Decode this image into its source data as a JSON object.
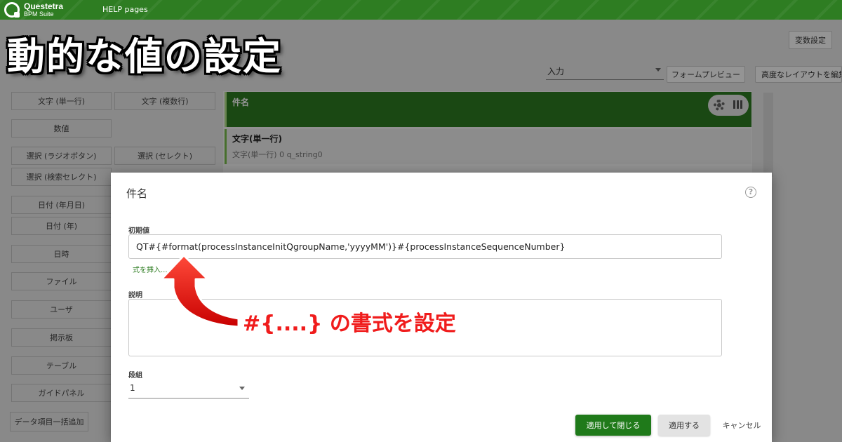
{
  "brand": {
    "name": "Questetra",
    "sub": "BPM Suite"
  },
  "topbar": {
    "help_label": "HELP pages"
  },
  "header": {
    "vars_button": "変数設定",
    "input_select": "入力",
    "form_preview_button": "フォームプレビュー",
    "advanced_layout_button": "高度なレイアウトを編集"
  },
  "palette": {
    "items": [
      "文字 (単一行)",
      "文字 (複数行)",
      "数値",
      "選択 (ラジオボタン)",
      "選択 (セレクト)",
      "選択 (検索セレクト)",
      "日付 (年月日)",
      "日付 (年)",
      "日時",
      "ファイル",
      "ユーザ",
      "掲示板",
      "テーブル",
      "ガイドパネル"
    ],
    "bulk_add_button": "データ項目一括追加"
  },
  "form": {
    "title_row_label": "件名",
    "row2_label": "文字(単一行)",
    "row2_desc": "文字(単一行) 0 q_string0"
  },
  "headline": "動的な値の設定",
  "dialog": {
    "title": "件名",
    "help_glyph": "?",
    "initial_label": "初期値",
    "initial_value": "QT#{#format(processInstanceInitQgroupName,'yyyyMM')}#{processInstanceSequenceNumber}",
    "insert_link": "式を挿入...",
    "desc_label": "説明",
    "desc_value": "",
    "dan_label": "段組",
    "dan_value": "1",
    "apply_close_button": "適用して閉じる",
    "apply_button": "適用する",
    "cancel_button": "キャンセル"
  },
  "annotation": "#{....} の書式を設定",
  "colors": {
    "brand_green": "#2e7d22",
    "annotation_red": "#f01c1c",
    "primary_button": "#1f7a1a"
  }
}
